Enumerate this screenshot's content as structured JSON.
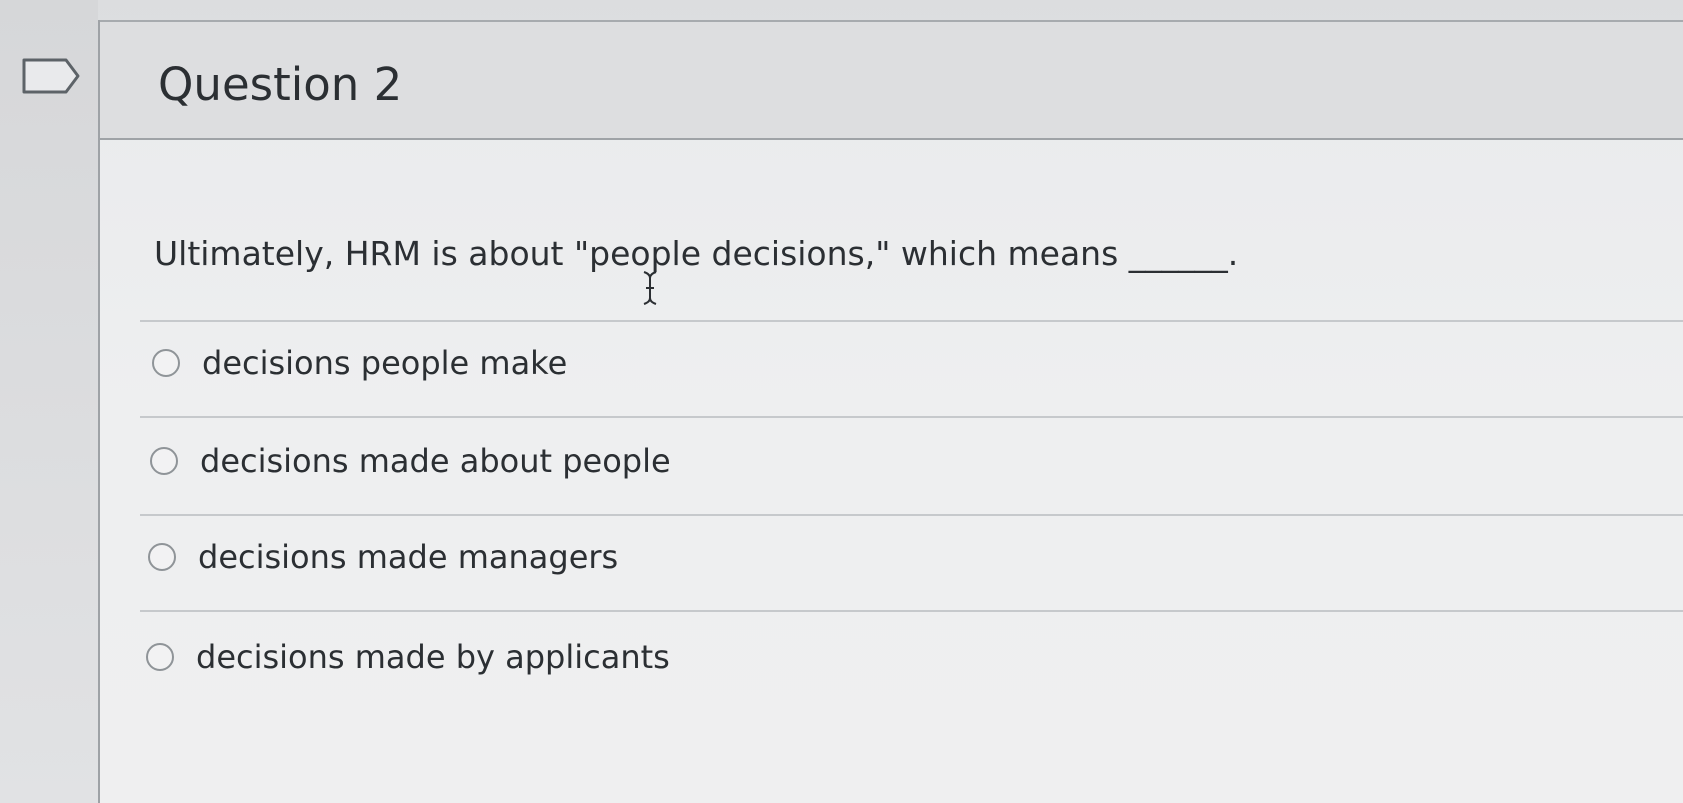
{
  "question": {
    "title": "Question 2",
    "text": "Ultimately, HRM is about \"people decisions,\" which means ______.",
    "answers": [
      {
        "label": "decisions people make",
        "selected": false
      },
      {
        "label": "decisions made about people",
        "selected": false
      },
      {
        "label": "decisions made managers",
        "selected": false
      },
      {
        "label": "decisions made by applicants",
        "selected": false
      }
    ]
  },
  "icons": {
    "flag": "flag-icon",
    "cursor": "text-cursor-icon"
  },
  "colors": {
    "header_bg": "#dddee0",
    "text": "#2b2f33",
    "divider": "#c6c9cc"
  }
}
